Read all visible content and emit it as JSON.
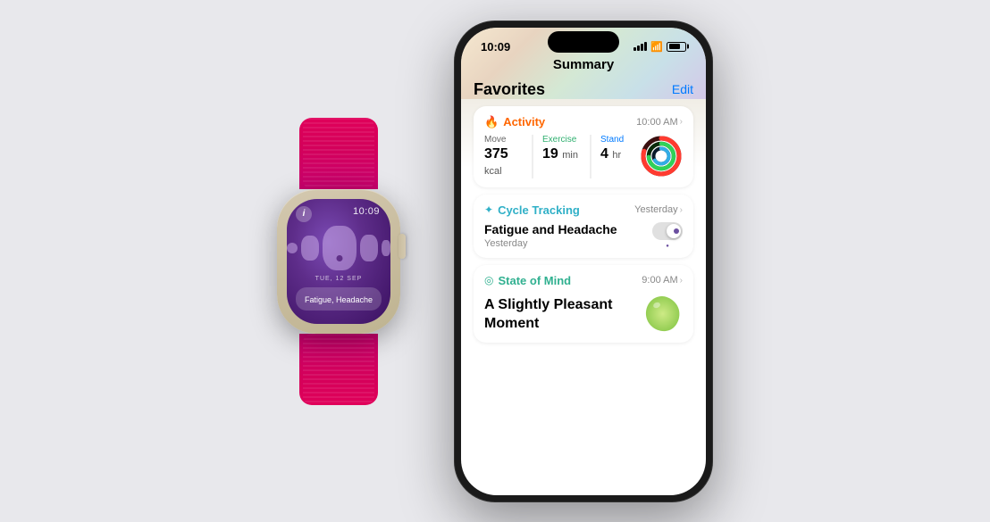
{
  "background_color": "#e8e8ec",
  "watch": {
    "time": "10:09",
    "date": "TUE, 12 SEP",
    "label": "Fatigue, Headache",
    "info_icon": "i"
  },
  "iphone": {
    "status_bar": {
      "time": "10:09",
      "signal": "signal-icon",
      "wifi": "wifi-icon",
      "battery": "battery-icon"
    },
    "screen_title": "Summary",
    "favorites": {
      "title": "Favorites",
      "edit_label": "Edit",
      "cards": [
        {
          "type": "activity",
          "icon": "🔥",
          "title": "Activity",
          "time": "10:00 AM",
          "stats": [
            {
              "label": "Move",
              "value": "375",
              "unit": "kcal"
            },
            {
              "label": "Exercise",
              "value": "19",
              "unit": "min"
            },
            {
              "label": "Stand",
              "value": "4",
              "unit": "hr"
            }
          ]
        },
        {
          "type": "cycle",
          "icon": "✦",
          "title": "Cycle Tracking",
          "time": "Yesterday",
          "symptom": "Fatigue and Headache",
          "symptom_date": "Yesterday"
        },
        {
          "type": "state",
          "icon": "◎",
          "title": "State of Mind",
          "time": "9:00 AM",
          "description": "A Slightly Pleasant\nMoment"
        }
      ]
    }
  }
}
